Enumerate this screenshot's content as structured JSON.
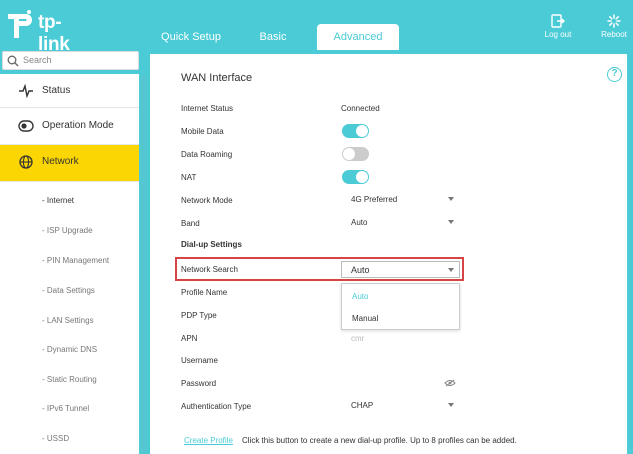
{
  "brand": {
    "name": "tp-link",
    "accent": "#4acbd6",
    "highlight": "#fbd602"
  },
  "tabs": {
    "quick_setup": "Quick Setup",
    "basic": "Basic",
    "advanced": "Advanced"
  },
  "header_buttons": {
    "logout": "Log out",
    "reboot": "Reboot"
  },
  "search": {
    "placeholder": "Search"
  },
  "sidebar": {
    "items": [
      {
        "label": "Status",
        "icon": "pulse-icon"
      },
      {
        "label": "Operation Mode",
        "icon": "toggle-icon"
      },
      {
        "label": "Network",
        "icon": "globe-icon",
        "active": true
      }
    ],
    "subitems": [
      "- Internet",
      "- ISP Upgrade",
      "- PIN Management",
      "- Data Settings",
      "- LAN Settings",
      "- Dynamic DNS",
      "- Static Routing",
      "- IPv6 Tunnel",
      "- USSD"
    ]
  },
  "main": {
    "title": "WAN Interface",
    "help": "?",
    "internet_status": {
      "label": "Internet Status",
      "value": "Connected"
    },
    "mobile_data": {
      "label": "Mobile Data",
      "state": "on"
    },
    "data_roaming": {
      "label": "Data Roaming",
      "state": "off"
    },
    "nat": {
      "label": "NAT",
      "state": "on"
    },
    "network_mode": {
      "label": "Network Mode",
      "value": "4G Preferred"
    },
    "band": {
      "label": "Band",
      "value": "Auto"
    },
    "dialup_section": "Dial-up Settings",
    "network_search": {
      "label": "Network Search",
      "value": "Auto",
      "options": [
        "Auto",
        "Manual"
      ]
    },
    "profile_name": {
      "label": "Profile Name"
    },
    "pdp_type": {
      "label": "PDP Type"
    },
    "apn": {
      "label": "APN",
      "value": "cmr"
    },
    "username": {
      "label": "Username"
    },
    "password": {
      "label": "Password"
    },
    "auth_type": {
      "label": "Authentication Type",
      "value": "CHAP"
    },
    "create_profile": {
      "link": "Create Profile",
      "description": "Click this button to create a new dial-up profile. Up to 8 profiles can be added."
    }
  }
}
